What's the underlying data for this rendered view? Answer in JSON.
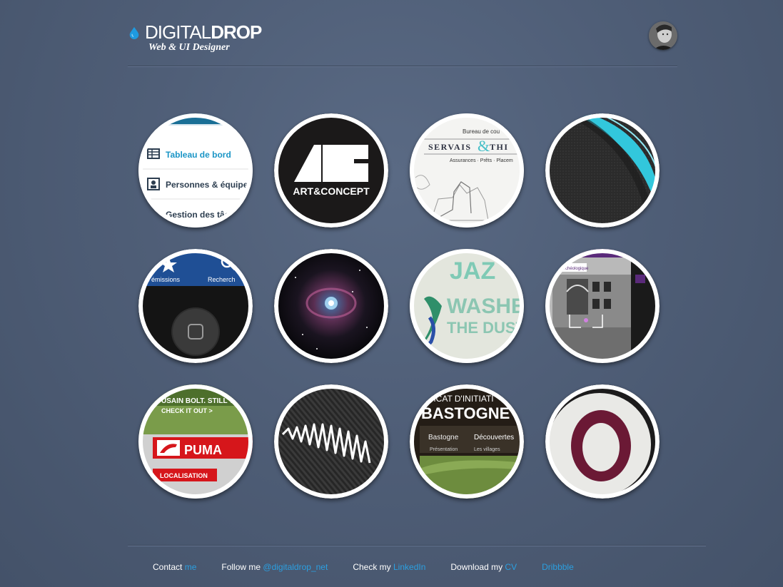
{
  "header": {
    "brand_light": "DIGITAL",
    "brand_bold": "DROP",
    "tagline": "Web & UI Designer"
  },
  "portfolio": {
    "c1": {
      "item1": "Tableau de bord",
      "item2": "Personnes & équipe",
      "item3": "Gestion des tâc"
    },
    "c2": {
      "label": "ART&CONCEPT"
    },
    "c3": {
      "top": "Bureau de cou",
      "name": "SERVAIS",
      "amp": "&",
      "name2": "THI",
      "sub": "Assurances · Prêts · Placem"
    },
    "c5": {
      "tab1": "es émissions",
      "tab2": "Recherch"
    },
    "c7": {
      "line1": "JAZ",
      "line2": "WASHES",
      "line3": "THE DUST"
    },
    "c8": {
      "tag": "Archéologique"
    },
    "c9": {
      "line1": "USAIN BOLT. STILL THE",
      "line2": "CHECK IT OUT >",
      "brand": "PUMA",
      "cta": "LOCALISATION"
    },
    "c11": {
      "top": "NDICAT D'INITIATI",
      "title": "BASTOGNE",
      "nav1": "Bastogne",
      "nav2": "Découvertes",
      "nav3": "Présentation",
      "nav4": "Les villages"
    }
  },
  "footer": [
    {
      "text": "Contact ",
      "link": "me"
    },
    {
      "text": "Follow me ",
      "link": "@digitaldrop_net"
    },
    {
      "text": "Check my ",
      "link": "LinkedIn"
    },
    {
      "text": "Download my ",
      "link": "CV"
    },
    {
      "text": "",
      "link": "Dribbble"
    }
  ],
  "colors": {
    "accent": "#2b9fe0",
    "background": "#4f5e77"
  }
}
